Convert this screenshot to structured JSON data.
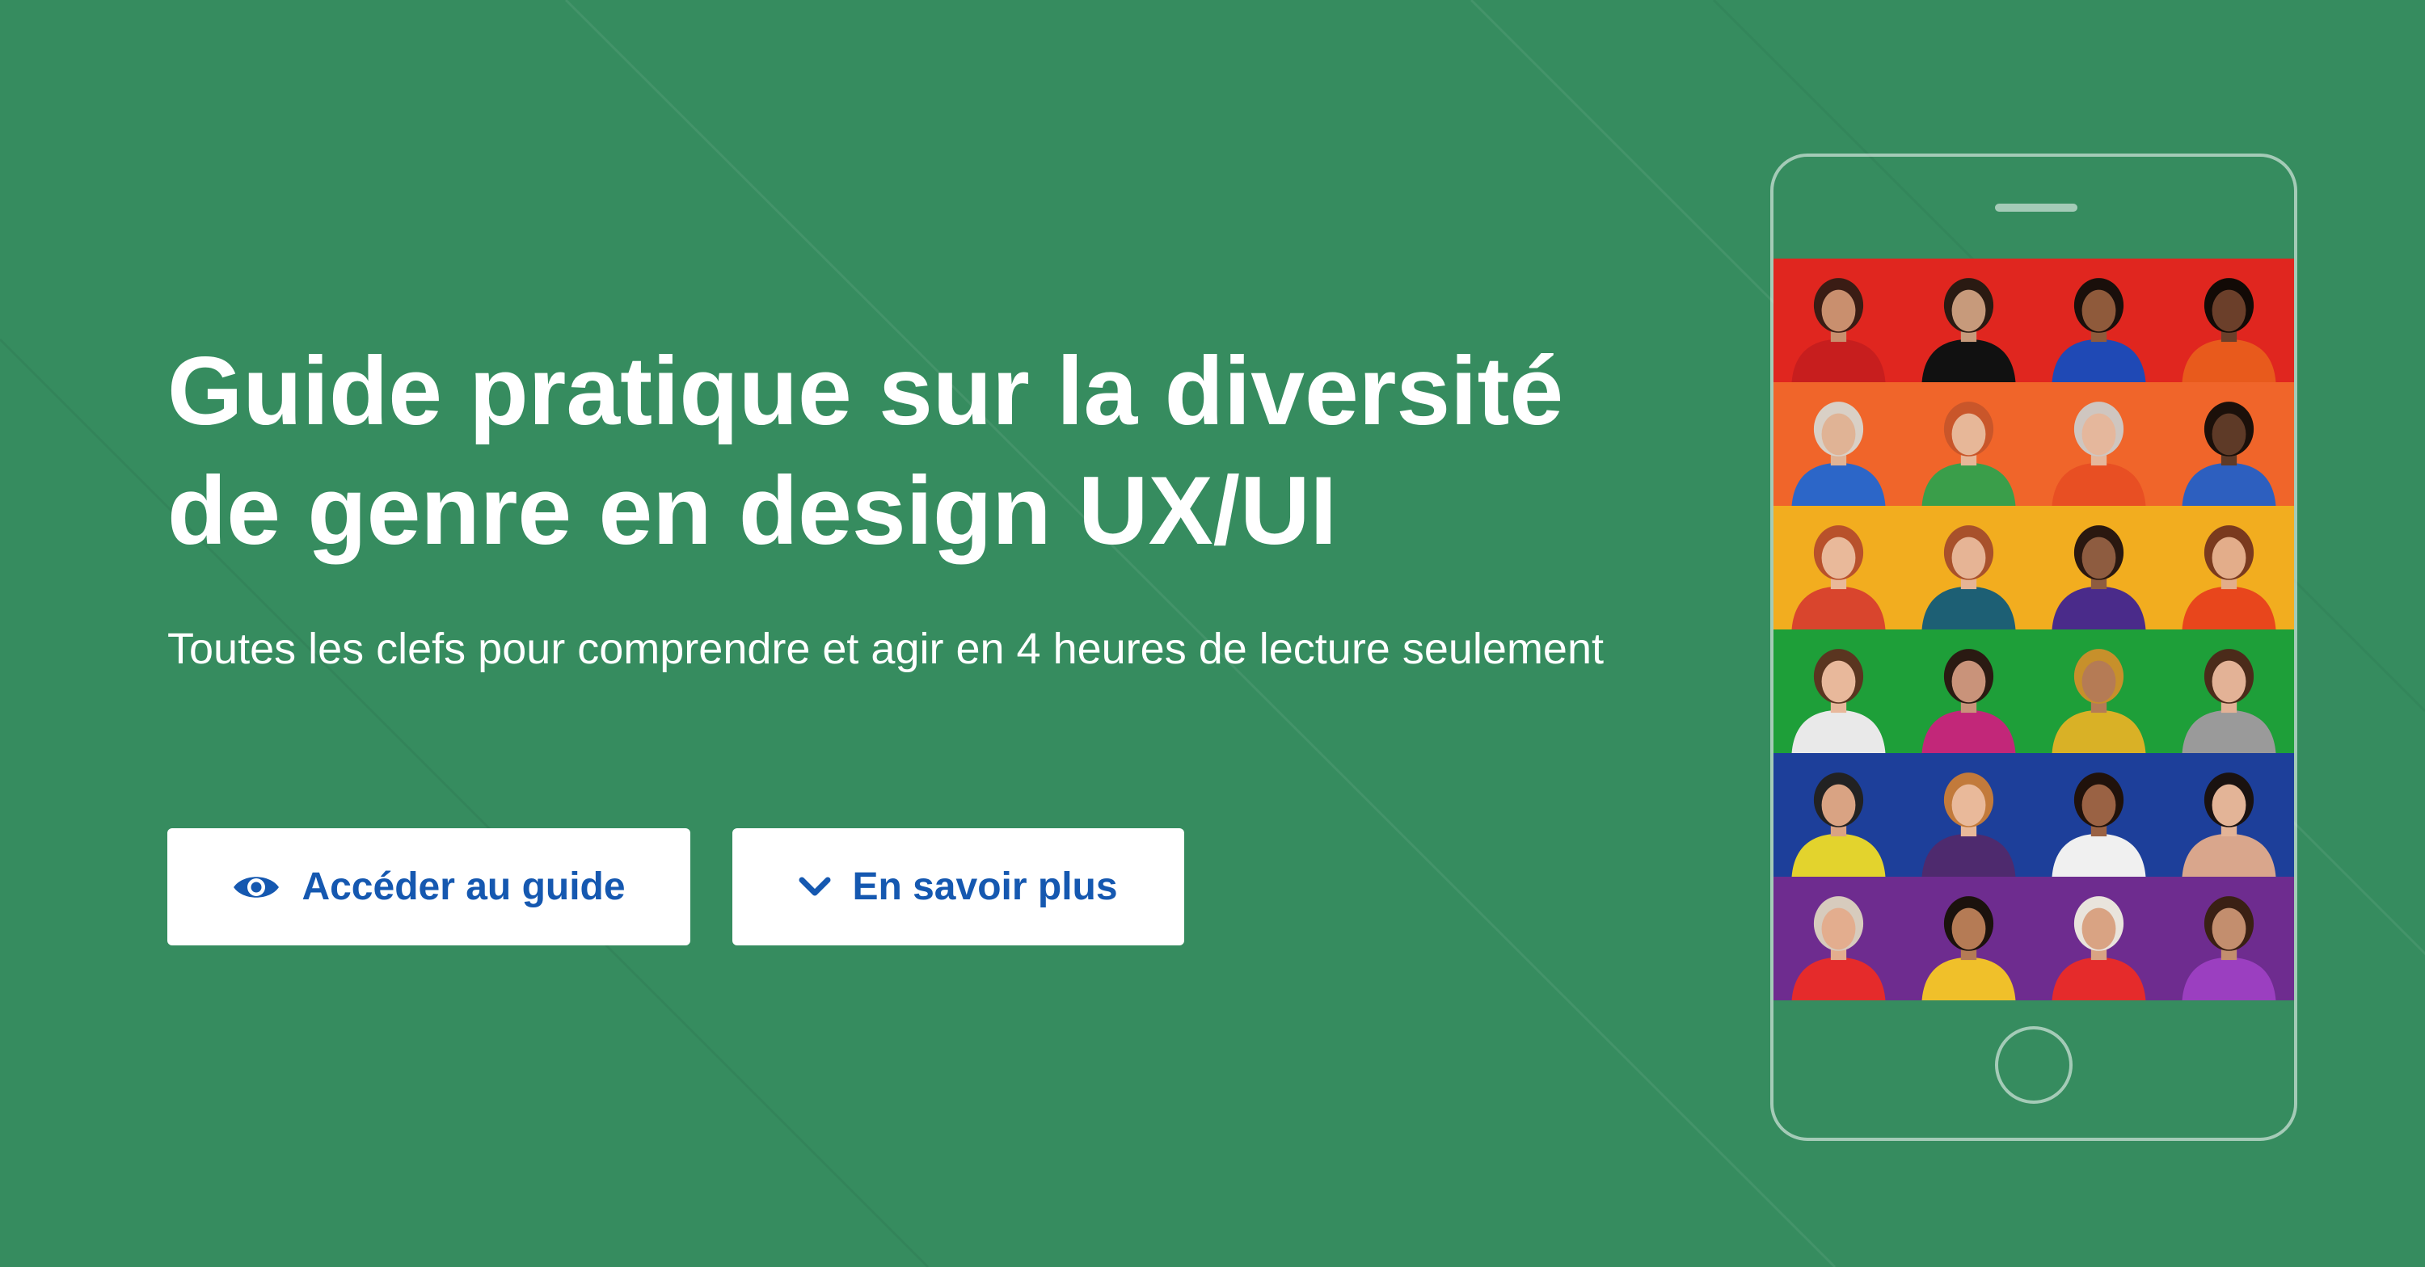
{
  "hero": {
    "title_line1": "Guide pratique sur la diversité",
    "title_line2": "de genre en design UX/UI",
    "subtitle": "Toutes les clefs pour comprendre et agir en 4 heures de lecture seulement"
  },
  "buttons": {
    "access_label": "Accéder au guide",
    "access_icon": "eye-icon",
    "more_label": "En savoir plus",
    "more_icon": "chevron-down-icon"
  },
  "colors": {
    "background": "#368c5f",
    "button_text": "#1558b0",
    "button_bg": "#ffffff",
    "title": "#ffffff"
  },
  "phone": {
    "rows": [
      {
        "bg": "#e0261f",
        "people": [
          {
            "skin": "#c98f6e",
            "hair": "#3a1c14",
            "shirt": "#c71e1e"
          },
          {
            "skin": "#c79a7b",
            "hair": "#2a1a12",
            "shirt": "#111111"
          },
          {
            "skin": "#8f5a3b",
            "hair": "#1a0f0b",
            "shirt": "#1f49b5"
          },
          {
            "skin": "#6b3f2a",
            "hair": "#120a06",
            "shirt": "#e85a1c"
          }
        ]
      },
      {
        "bg": "#f0652a",
        "people": [
          {
            "skin": "#e0b395",
            "hair": "#d9d0c6",
            "shirt": "#2c66c8"
          },
          {
            "skin": "#e7b798",
            "hair": "#c9562a",
            "shirt": "#3a9e4a"
          },
          {
            "skin": "#e5b79c",
            "hair": "#cfc6c0",
            "shirt": "#e84f23"
          },
          {
            "skin": "#5e3a27",
            "hair": "#1b100a",
            "shirt": "#2d5fbf"
          }
        ]
      },
      {
        "bg": "#f2ad1f",
        "people": [
          {
            "skin": "#e9b99a",
            "hair": "#b8512b",
            "shirt": "#d9452d"
          },
          {
            "skin": "#e6b495",
            "hair": "#a8512b",
            "shirt": "#1d5f74"
          },
          {
            "skin": "#8e5c40",
            "hair": "#2a1810",
            "shirt": "#4a2b8a"
          },
          {
            "skin": "#e3ad8a",
            "hair": "#7a3a1e",
            "shirt": "#e8461c"
          }
        ]
      },
      {
        "bg": "#1e9f39",
        "people": [
          {
            "skin": "#e8b89b",
            "hair": "#5a3520",
            "shirt": "#e9e9e9"
          },
          {
            "skin": "#c9937a",
            "hair": "#2a1a12",
            "shirt": "#c22779"
          },
          {
            "skin": "#b57b55",
            "hair": "#c7902b",
            "shirt": "#d9b126"
          },
          {
            "skin": "#e3b296",
            "hair": "#4b2b1a",
            "shirt": "#9a9a9a"
          }
        ]
      },
      {
        "bg": "#1d3f9a",
        "people": [
          {
            "skin": "#d9a383",
            "hair": "#222222",
            "shirt": "#e3d32d"
          },
          {
            "skin": "#e9b99a",
            "hair": "#c27a3b",
            "shirt": "#4e2a6e"
          },
          {
            "skin": "#9a6244",
            "hair": "#20120b",
            "shirt": "#f0f0f0"
          },
          {
            "skin": "#e3b497",
            "hair": "#1a1210",
            "shirt": "#d9a68c"
          }
        ]
      },
      {
        "bg": "#6e2c8f",
        "people": [
          {
            "skin": "#e3ad8e",
            "hair": "#d7cbbd",
            "shirt": "#e52b2b"
          },
          {
            "skin": "#b57b55",
            "hair": "#1b120d",
            "shirt": "#f0c02a"
          },
          {
            "skin": "#d9a383",
            "hair": "#e9e4dc",
            "shirt": "#e52b2b"
          },
          {
            "skin": "#c38e6e",
            "hair": "#3a2014",
            "shirt": "#9b3fc0"
          }
        ]
      }
    ]
  }
}
